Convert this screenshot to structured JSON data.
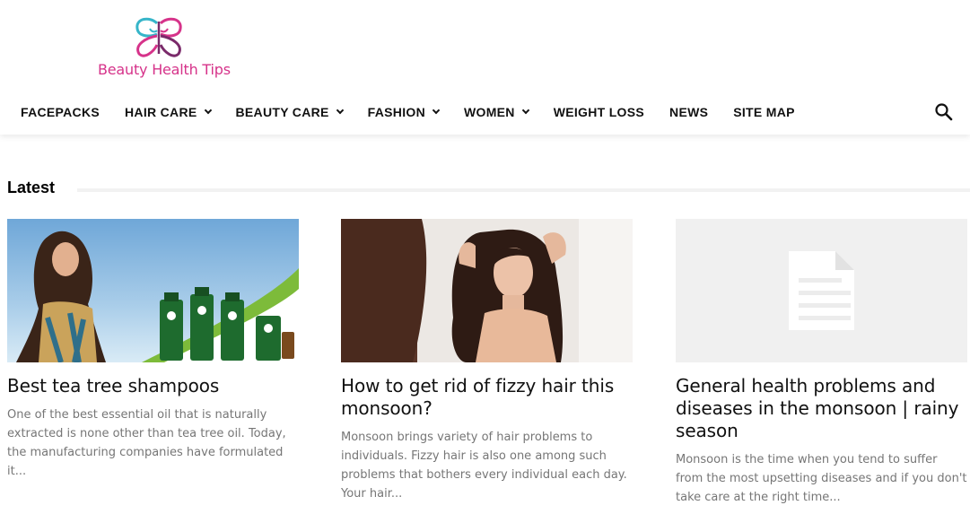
{
  "site": {
    "logo_text": "Beauty Health Tips",
    "brand_color": "#d6338a"
  },
  "nav": {
    "items": [
      {
        "label": "FACEPACKS",
        "dropdown": false
      },
      {
        "label": "HAIR CARE",
        "dropdown": true
      },
      {
        "label": "BEAUTY CARE",
        "dropdown": true
      },
      {
        "label": "FASHION",
        "dropdown": true
      },
      {
        "label": "WOMEN",
        "dropdown": true
      },
      {
        "label": "WEIGHT LOSS",
        "dropdown": false
      },
      {
        "label": "NEWS",
        "dropdown": false
      },
      {
        "label": "SITE MAP",
        "dropdown": false
      }
    ],
    "search_icon": "search-icon"
  },
  "latest": {
    "heading": "Latest",
    "posts": [
      {
        "title": "Best tea tree shampoos",
        "excerpt": "One of the best essential oil that is naturally extracted is none other than tea tree oil. Today, the manufacturing companies have formulated it...",
        "image": "woman-with-tea-tree-shampoo-bottles"
      },
      {
        "title": "How to get rid of fizzy hair this monsoon?",
        "excerpt": "Monsoon brings variety of hair problems to individuals. Fizzy hair is also one among such problems that bothers every individual each day. Your hair...",
        "image": "woman-with-frizzy-hair-at-mirror"
      },
      {
        "title": "General health problems and diseases in the monsoon | rainy season",
        "excerpt": "Monsoon is the time when you tend to suffer from the most upsetting diseases and if you don't take care at the right time...",
        "image": "document-placeholder-icon"
      }
    ]
  }
}
